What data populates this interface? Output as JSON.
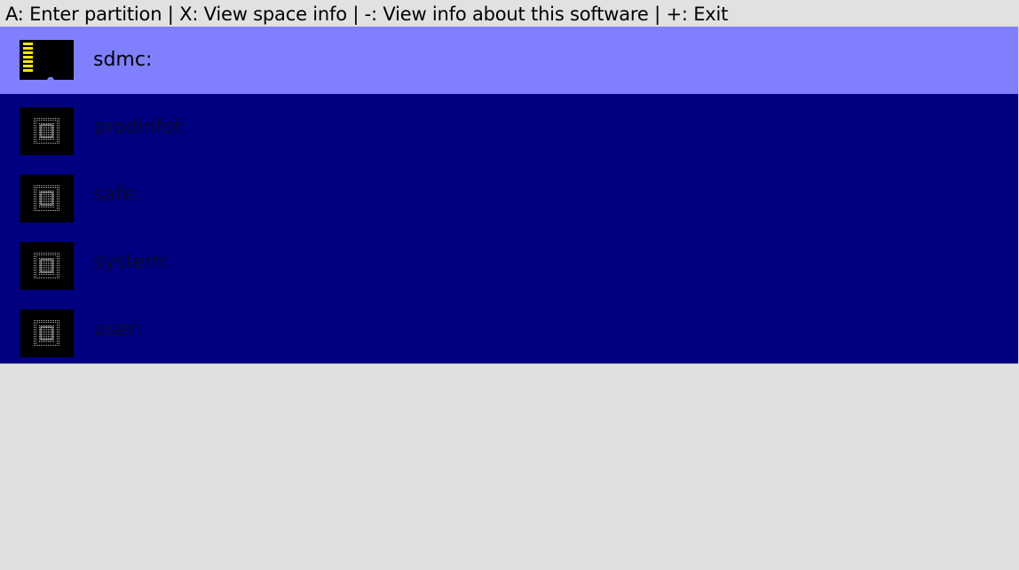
{
  "hint_bar": {
    "text": "A: Enter partition | X: View space info | -: View info about this software | +: Exit"
  },
  "partitions": [
    {
      "label": "sdmc:",
      "icon": "sd-card-icon",
      "selected": true
    },
    {
      "label": "prodinfof:",
      "icon": "emmc-chip-icon",
      "selected": false
    },
    {
      "label": "safe:",
      "icon": "emmc-chip-icon",
      "selected": false
    },
    {
      "label": "system:",
      "icon": "emmc-chip-icon",
      "selected": false
    },
    {
      "label": "user:",
      "icon": "emmc-chip-icon",
      "selected": false
    }
  ],
  "colors": {
    "list_background": "#000080",
    "selected_background": "#8080ff",
    "page_background": "#e0e0e0",
    "sd_contacts": "#f5e60a"
  }
}
